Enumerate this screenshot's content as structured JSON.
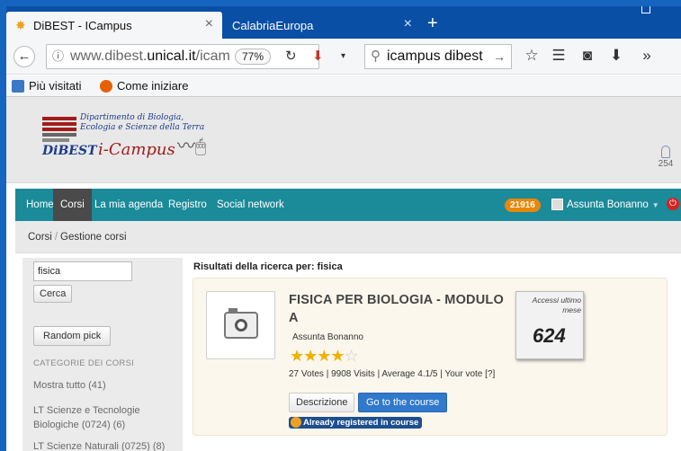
{
  "browser": {
    "active_tab": {
      "title": "DiBEST - ICampus",
      "close": "×"
    },
    "inactive_tab": {
      "title": "CalabriaEuropa",
      "close": "×"
    },
    "new_tab": "+",
    "url_prefix": "www.dibest.",
    "url_domain": "unical.it",
    "url_suffix": "/icam",
    "zoom": "77%",
    "search_value": "icampus dibest",
    "bookmarks": [
      "Più visitati",
      "Come iniziare"
    ]
  },
  "site": {
    "logo_line1": "Dipartimento di Biologia,",
    "logo_line2": "Ecologia e Scienze della Terra",
    "logo_dibest": "DiBEST",
    "logo_icampus": "i-Campus",
    "online_count": "254",
    "menu": [
      "Home",
      "Corsi",
      "La mia agenda",
      "Registro",
      "Social network"
    ],
    "notification_badge": "21916",
    "user_name": "Assunta Bonanno",
    "breadcrumb": [
      "Corsi",
      "Gestione corsi"
    ]
  },
  "sidebar": {
    "search_value": "fisica",
    "search_button": "Cerca",
    "random_button": "Random pick",
    "categories_heading": "CATEGORIE DEI CORSI",
    "categories": [
      "Mostra tutto (41)",
      "LT Scienze e Tecnologie Biologiche (0724) (6)",
      "LT Scienze Naturali (0725) (8)"
    ]
  },
  "results": {
    "heading": "Risultati della ricerca per: fisica",
    "course": {
      "title": "FISICA PER BIOLOGIA - MODULO A",
      "author": "Assunta Bonanno",
      "rating": 4,
      "rating_max": 5,
      "votes_line": "27 Votes | 9908 Visits | Average 4.1/5 | Your vote [?]",
      "desc_button": "Descrizione",
      "go_button": "Go to the course",
      "registered": "Already registered in course",
      "access_label": "Accessi ultimo mese",
      "access_count": "624"
    }
  },
  "colors": {
    "menu_teal": "#1b8a99",
    "badge_orange": "#e8870e",
    "primary_blue": "#3079cc",
    "frame_blue": "#1565c0"
  }
}
